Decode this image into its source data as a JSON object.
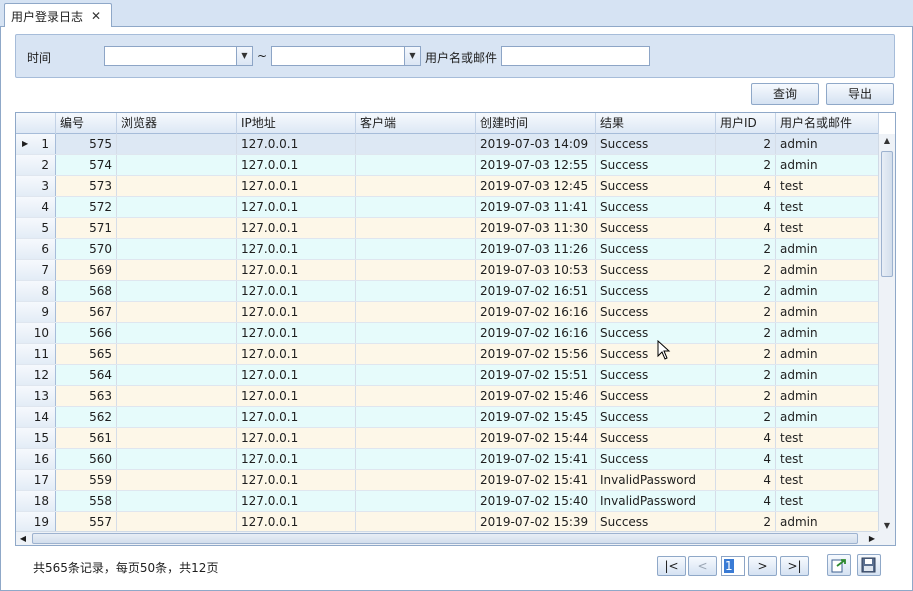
{
  "tab": {
    "label": "用户登录日志",
    "close": "✕"
  },
  "filter": {
    "time_label": "时间",
    "tilde": "~",
    "start_value": "",
    "end_value": "",
    "user_label": "用户名或邮件",
    "user_value": ""
  },
  "buttons": {
    "query": "查询",
    "export": "导出"
  },
  "columns": [
    "编号",
    "浏览器",
    "IP地址",
    "客户端",
    "创建时间",
    "结果",
    "用户ID",
    "用户名或邮件"
  ],
  "rows": [
    {
      "n": "1",
      "id": "575",
      "browser": "",
      "ip": "127.0.0.1",
      "client": "",
      "time": "2019-07-03 14:09",
      "result": "Success",
      "uid": "2",
      "user": "admin"
    },
    {
      "n": "2",
      "id": "574",
      "browser": "",
      "ip": "127.0.0.1",
      "client": "",
      "time": "2019-07-03 12:55",
      "result": "Success",
      "uid": "2",
      "user": "admin"
    },
    {
      "n": "3",
      "id": "573",
      "browser": "",
      "ip": "127.0.0.1",
      "client": "",
      "time": "2019-07-03 12:45",
      "result": "Success",
      "uid": "4",
      "user": "test"
    },
    {
      "n": "4",
      "id": "572",
      "browser": "",
      "ip": "127.0.0.1",
      "client": "",
      "time": "2019-07-03 11:41",
      "result": "Success",
      "uid": "4",
      "user": "test"
    },
    {
      "n": "5",
      "id": "571",
      "browser": "",
      "ip": "127.0.0.1",
      "client": "",
      "time": "2019-07-03 11:30",
      "result": "Success",
      "uid": "4",
      "user": "test"
    },
    {
      "n": "6",
      "id": "570",
      "browser": "",
      "ip": "127.0.0.1",
      "client": "",
      "time": "2019-07-03 11:26",
      "result": "Success",
      "uid": "2",
      "user": "admin"
    },
    {
      "n": "7",
      "id": "569",
      "browser": "",
      "ip": "127.0.0.1",
      "client": "",
      "time": "2019-07-03 10:53",
      "result": "Success",
      "uid": "2",
      "user": "admin"
    },
    {
      "n": "8",
      "id": "568",
      "browser": "",
      "ip": "127.0.0.1",
      "client": "",
      "time": "2019-07-02 16:51",
      "result": "Success",
      "uid": "2",
      "user": "admin"
    },
    {
      "n": "9",
      "id": "567",
      "browser": "",
      "ip": "127.0.0.1",
      "client": "",
      "time": "2019-07-02 16:16",
      "result": "Success",
      "uid": "2",
      "user": "admin"
    },
    {
      "n": "10",
      "id": "566",
      "browser": "",
      "ip": "127.0.0.1",
      "client": "",
      "time": "2019-07-02 16:16",
      "result": "Success",
      "uid": "2",
      "user": "admin"
    },
    {
      "n": "11",
      "id": "565",
      "browser": "",
      "ip": "127.0.0.1",
      "client": "",
      "time": "2019-07-02 15:56",
      "result": "Success",
      "uid": "2",
      "user": "admin"
    },
    {
      "n": "12",
      "id": "564",
      "browser": "",
      "ip": "127.0.0.1",
      "client": "",
      "time": "2019-07-02 15:51",
      "result": "Success",
      "uid": "2",
      "user": "admin"
    },
    {
      "n": "13",
      "id": "563",
      "browser": "",
      "ip": "127.0.0.1",
      "client": "",
      "time": "2019-07-02 15:46",
      "result": "Success",
      "uid": "2",
      "user": "admin"
    },
    {
      "n": "14",
      "id": "562",
      "browser": "",
      "ip": "127.0.0.1",
      "client": "",
      "time": "2019-07-02 15:45",
      "result": "Success",
      "uid": "2",
      "user": "admin"
    },
    {
      "n": "15",
      "id": "561",
      "browser": "",
      "ip": "127.0.0.1",
      "client": "",
      "time": "2019-07-02 15:44",
      "result": "Success",
      "uid": "4",
      "user": "test"
    },
    {
      "n": "16",
      "id": "560",
      "browser": "",
      "ip": "127.0.0.1",
      "client": "",
      "time": "2019-07-02 15:41",
      "result": "Success",
      "uid": "4",
      "user": "test"
    },
    {
      "n": "17",
      "id": "559",
      "browser": "",
      "ip": "127.0.0.1",
      "client": "",
      "time": "2019-07-02 15:41",
      "result": "InvalidPassword",
      "uid": "4",
      "user": "test"
    },
    {
      "n": "18",
      "id": "558",
      "browser": "",
      "ip": "127.0.0.1",
      "client": "",
      "time": "2019-07-02 15:40",
      "result": "InvalidPassword",
      "uid": "4",
      "user": "test"
    },
    {
      "n": "19",
      "id": "557",
      "browser": "",
      "ip": "127.0.0.1",
      "client": "",
      "time": "2019-07-02 15:39",
      "result": "Success",
      "uid": "2",
      "user": "admin"
    }
  ],
  "pager": {
    "summary": "共565条记录，每页50条，共12页",
    "first": "|<",
    "prev": "<",
    "current": "1",
    "next": ">",
    "last": ">|"
  },
  "icons": {
    "combo_arrow": "▼",
    "row_indicator": "▶",
    "scroll_up": "▲",
    "scroll_down": "▼",
    "scroll_left": "◀",
    "scroll_right": "▶",
    "export_icon": "export-icon",
    "save_icon": "save-icon"
  }
}
